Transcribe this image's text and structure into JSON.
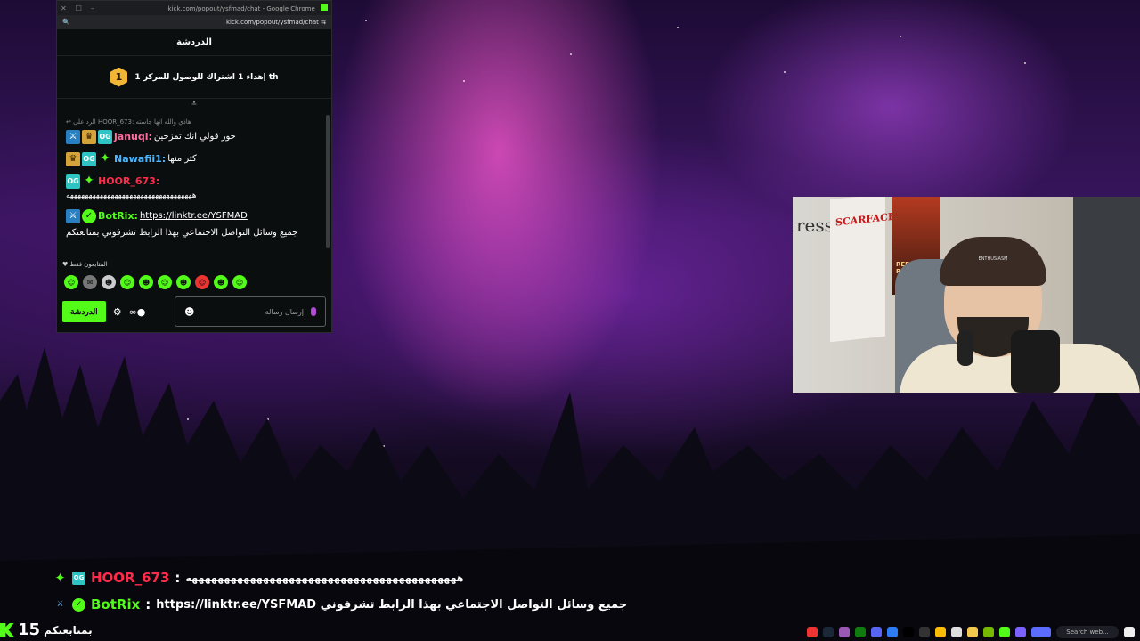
{
  "chat_window": {
    "title": "kick.com/popout/ysfmad/chat - Google Chrome",
    "url": "kick.com/popout/ysfmad/chat",
    "header": "الدردشة",
    "sub_goal": {
      "number": "1",
      "text": "إهداء 1 اشتراك للوصول للمركز 1 th"
    },
    "reply_line": "الرد على HOOR_673: هاذي والله انها جاسته",
    "messages": [
      {
        "user": "januqi:",
        "user_color": "#ff6fa0",
        "text": "حور قولي انك تمزحين"
      },
      {
        "user": "Nawafii1:",
        "user_color": "#4fb7ff",
        "text": "كثر منها"
      },
      {
        "user": "HOOR_673:",
        "user_color": "#ff2b4a",
        "text": "ههههههههههههههههههههههههههههههههههه"
      },
      {
        "user": "BotRix:",
        "user_color": "#53fc18",
        "link": "https://linktr.ee/YSFMAD",
        "text": "جميع وسائل التواصل الاجتماعي بهذا الرابط تشرفوني بمتابعتكم"
      }
    ],
    "followers_only": "المتابعون فقط",
    "send_label": "الدردشة",
    "input_placeholder": "إرسال رسالة"
  },
  "webcam": {
    "wall_text": "ress",
    "poster1_text": "SCARFACE",
    "poster2_text": "RED DEAD REDEMPTION",
    "cap_text": "ENTHUSIASM"
  },
  "overlay_chat": [
    {
      "user": "HOOR_673",
      "user_color": "#ff2b4a",
      "separator": ":",
      "text": "ههههههههههههههههههههههههههههههههههههههههههه"
    },
    {
      "user": "BotRix",
      "user_color": "#53fc18",
      "separator": ":",
      "text": "https://linktr.ee/YSFMAD جميع وسائل التواصل الاجتماعي بهذا الرابط تشرفوني"
    }
  ],
  "follow_counter": {
    "count": "15",
    "label": "بمتابعتكم"
  },
  "taskbar": {
    "search_placeholder": "Search web..."
  },
  "colors": {
    "kick_green": "#53fc18",
    "chat_bg": "#0b0e0f"
  }
}
